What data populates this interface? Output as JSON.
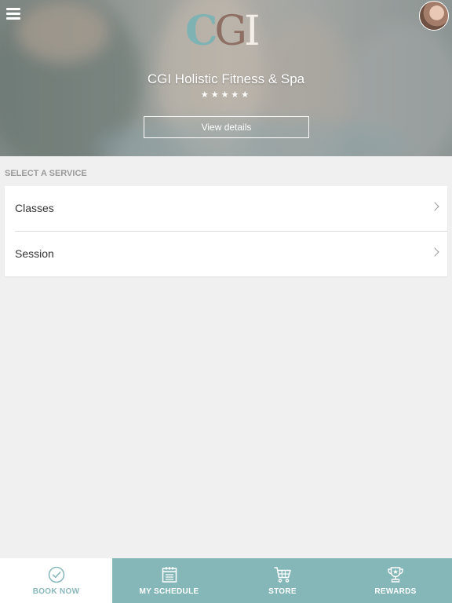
{
  "header": {
    "logo_text": "CGI",
    "studio_name": "CGI Holistic Fitness & Spa",
    "rating": "★★★★★",
    "view_details_label": "View details"
  },
  "services": {
    "section_label": "SELECT A SERVICE",
    "items": [
      {
        "label": "Classes"
      },
      {
        "label": "Session"
      }
    ]
  },
  "bottom_nav": {
    "tabs": [
      {
        "label": "BOOK NOW",
        "icon": "check-circle-icon",
        "active": true
      },
      {
        "label": "MY SCHEDULE",
        "icon": "calendar-icon",
        "active": false
      },
      {
        "label": "STORE",
        "icon": "cart-icon",
        "active": false
      },
      {
        "label": "REWARDS",
        "icon": "trophy-icon",
        "active": false
      }
    ]
  },
  "colors": {
    "accent": "#85b7b8",
    "active_tab_text": "#8ab9bb",
    "background": "#f0f0f0"
  }
}
